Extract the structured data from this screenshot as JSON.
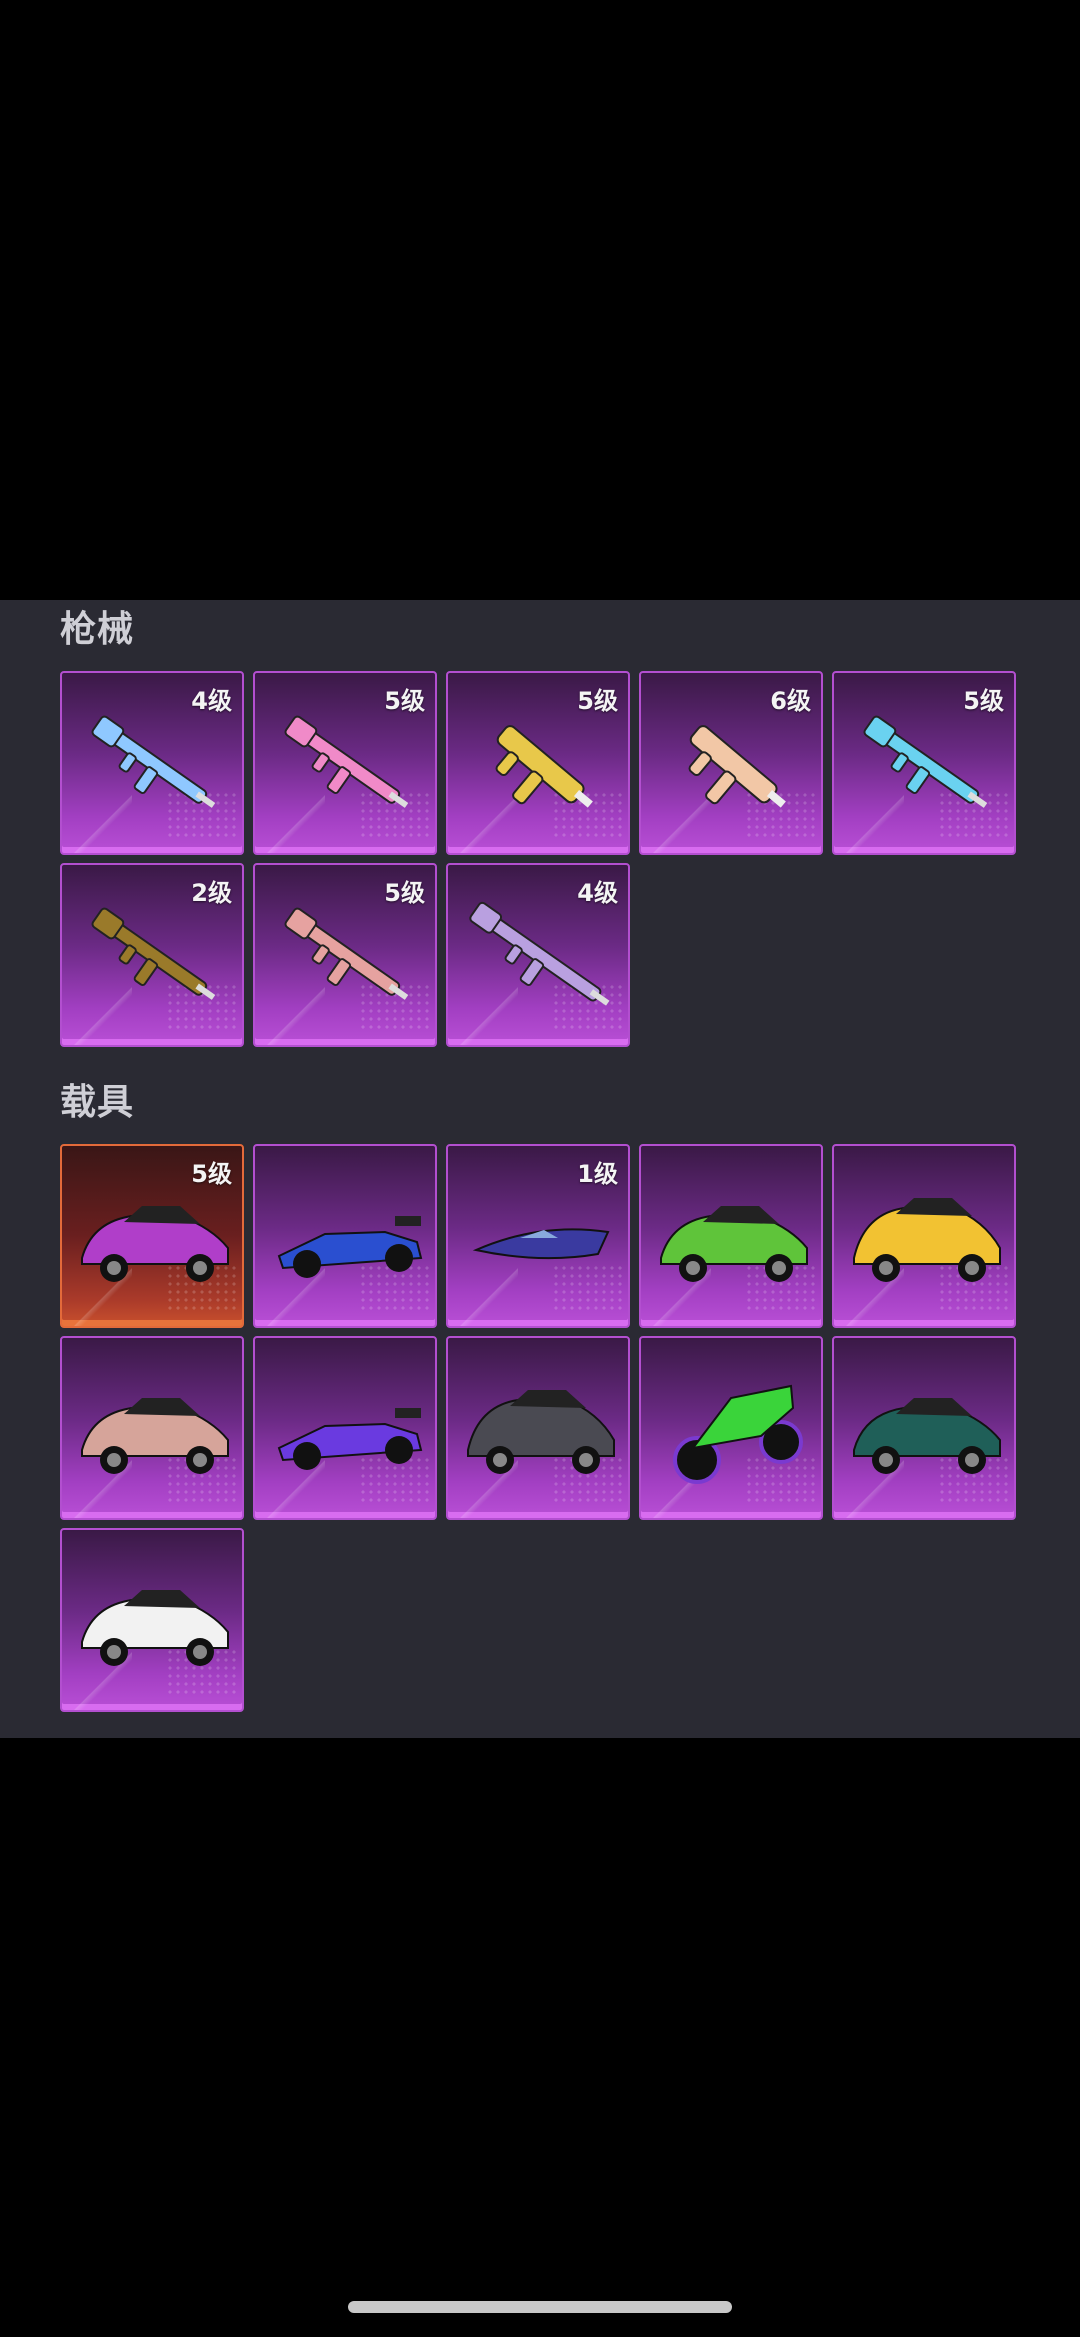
{
  "sections": {
    "weapons": {
      "title": "枪械",
      "items": [
        {
          "level": "4级",
          "icon": "rifle-icon",
          "color": "#8fc8ff"
        },
        {
          "level": "5级",
          "icon": "rifle-icon",
          "color": "#f08ac8"
        },
        {
          "level": "5级",
          "icon": "smg-icon",
          "color": "#e8c84a"
        },
        {
          "level": "6级",
          "icon": "smg-icon",
          "color": "#f2c7a6"
        },
        {
          "level": "5级",
          "icon": "rifle-icon",
          "color": "#6ad2f0"
        },
        {
          "level": "2级",
          "icon": "rifle-icon",
          "color": "#9a7a2a"
        },
        {
          "level": "5级",
          "icon": "rifle-icon",
          "color": "#e6a2a0"
        },
        {
          "level": "4级",
          "icon": "sniper-icon",
          "color": "#b9a0e0"
        }
      ]
    },
    "vehicles": {
      "title": "载具",
      "items": [
        {
          "level": "5级",
          "icon": "car-icon",
          "color": "#b03ec9",
          "rarity": "orange"
        },
        {
          "level": "",
          "icon": "race-car-icon",
          "color": "#2a4fd0"
        },
        {
          "level": "1级",
          "icon": "boat-icon",
          "color": "#3a3aa0"
        },
        {
          "level": "",
          "icon": "car-icon",
          "color": "#5fc43a"
        },
        {
          "level": "",
          "icon": "suv-icon",
          "color": "#f2c232"
        },
        {
          "level": "",
          "icon": "car-icon",
          "color": "#d6a49a"
        },
        {
          "level": "",
          "icon": "race-car-icon",
          "color": "#6a3ae0"
        },
        {
          "level": "",
          "icon": "suv-icon",
          "color": "#4a4a52"
        },
        {
          "level": "",
          "icon": "motorcycle-icon",
          "color": "#3ad43a"
        },
        {
          "level": "",
          "icon": "car-icon",
          "color": "#1f5f58"
        },
        {
          "level": "",
          "icon": "car-icon",
          "color": "#f2f2f2"
        }
      ]
    }
  }
}
